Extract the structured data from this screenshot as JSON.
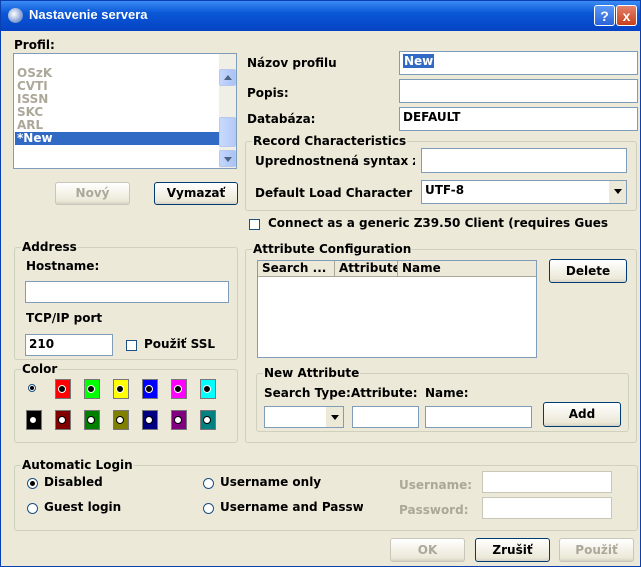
{
  "window": {
    "title": "Nastavenie servera",
    "help_label": "?",
    "close_label": "x"
  },
  "profile": {
    "label": "Profil:",
    "items": [
      "OSzK",
      "CVTI",
      "ISSN",
      "SKC",
      "ARL",
      "*New"
    ],
    "selected": "*New",
    "new_button": "Nový",
    "delete_button": "Vymazať"
  },
  "fields": {
    "name_label": "Názov profilu",
    "name_value": "New",
    "description_label": "Popis:",
    "description_value": "",
    "database_label": "Databáza:",
    "database_value": "DEFAULT"
  },
  "record": {
    "group_title": "Record Characteristics",
    "syntax_label": "Uprednostnená syntax z",
    "syntax_value": "",
    "charset_label": "Default Load Character S",
    "charset_value": "UTF-8"
  },
  "generic_client": {
    "label": "Connect as a generic Z39.50 Client (requires Gues",
    "checked": false
  },
  "address": {
    "group_title": "Address",
    "hostname_label": "Hostname:",
    "hostname_value": "",
    "port_label": "TCP/IP port",
    "port_value": "210",
    "ssl_label": "Použiť SSL",
    "ssl_checked": false
  },
  "color": {
    "group_title": "Color",
    "selected_index": 0,
    "row1": [
      "#ffffff",
      "#ff0000",
      "#00ff00",
      "#ffff00",
      "#0000ff",
      "#ff00ff",
      "#00ffff"
    ],
    "row2": [
      "#000000",
      "#800000",
      "#008000",
      "#808000",
      "#000080",
      "#800080",
      "#008080"
    ]
  },
  "attributes": {
    "group_title": "Attribute Configuration",
    "columns": [
      "Search ...",
      "Attribute",
      "Name"
    ],
    "delete_button": "Delete",
    "new_group_title": "New Attribute",
    "search_type_label": "Search Type:",
    "attribute_label": "Attribute:",
    "name_label": "Name:",
    "add_button": "Add"
  },
  "login": {
    "group_title": "Automatic Login",
    "disabled_label": "Disabled",
    "guest_label": "Guest login",
    "username_only_label": "Username only",
    "username_password_label": "Username and Passw",
    "selected": "Disabled",
    "username_label": "Username:",
    "password_label": "Password:"
  },
  "footer": {
    "ok_button": "OK",
    "cancel_button": "Zrušiť",
    "apply_button": "Použiť"
  }
}
